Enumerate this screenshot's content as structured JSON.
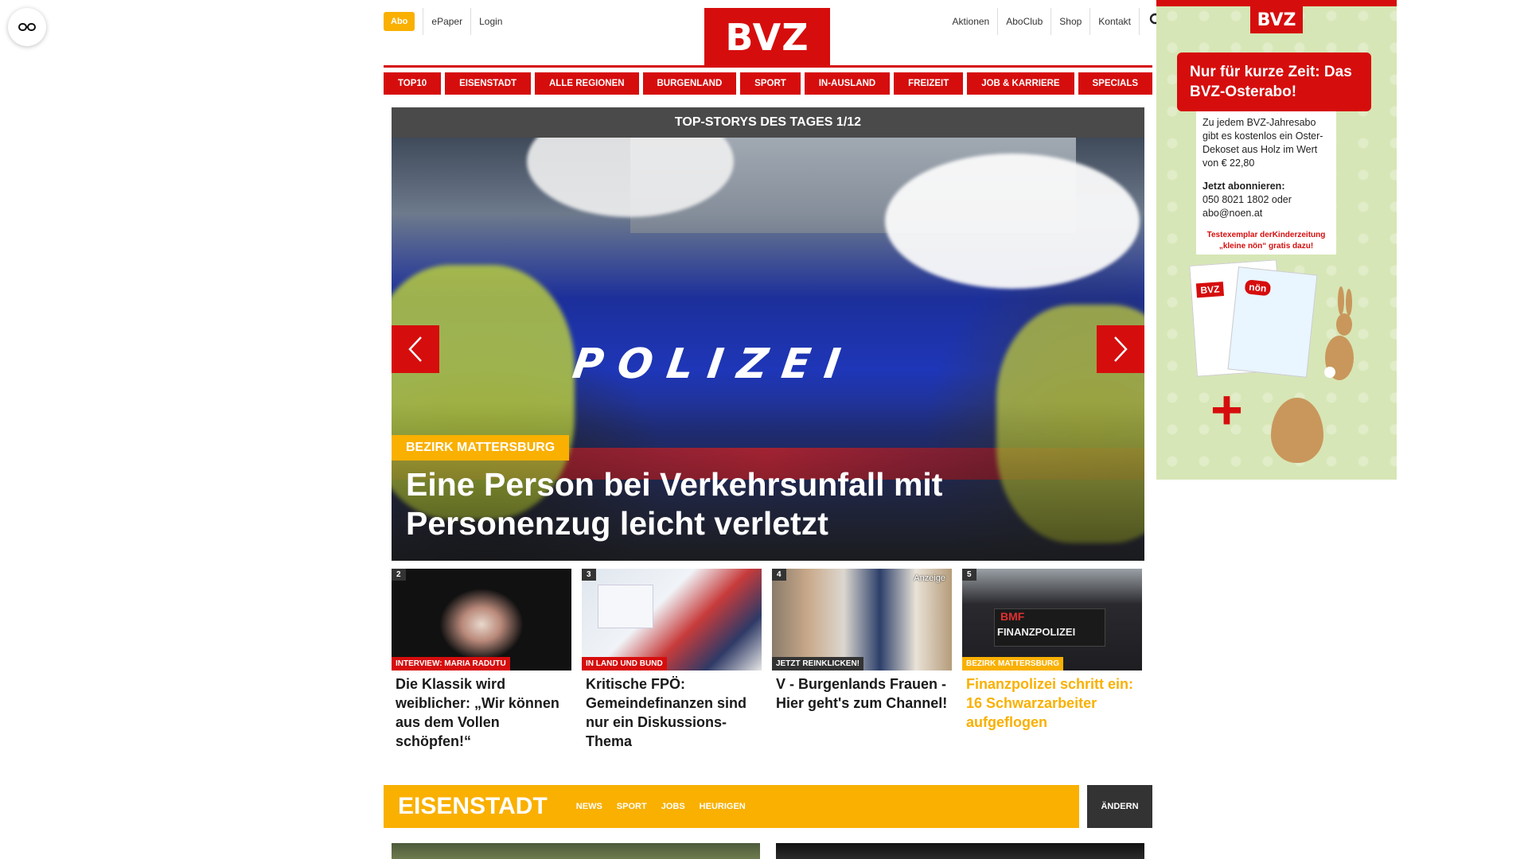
{
  "header": {
    "abo_label": "Abo",
    "left_links": [
      "ePaper",
      "Login"
    ],
    "logo_text": "BVZ",
    "right_links": [
      "Aktionen",
      "AboClub",
      "Shop",
      "Kontakt"
    ]
  },
  "nav": {
    "items": [
      "TOP10",
      "EISENSTADT",
      "ALLE REGIONEN",
      "BURGENLAND",
      "SPORT",
      "IN-AUSLAND",
      "FREIZEIT",
      "JOB & KARRIERE",
      "SPECIALS"
    ]
  },
  "hero": {
    "section_title": "TOP-STORYS DES TAGES 1/12",
    "image_text": "POLIZEI",
    "tag": "BEZIRK MATTERSBURG",
    "headline": "Eine Person bei Verkehrsunfall mit Personenzug leicht verletzt"
  },
  "teasers": [
    {
      "num": "2",
      "tag": "INTERVIEW: MARIA RADUTU",
      "title": "Die Klassik wird weiblicher: „Wir können aus dem Vollen schöpfen!“",
      "ad": ""
    },
    {
      "num": "3",
      "tag": "IN LAND UND BUND",
      "title": "Kritische FPÖ: Gemeindefinanzen sind nur ein Diskussions-Thema",
      "ad": ""
    },
    {
      "num": "4",
      "tag": "JETZT REINKLICKEN!",
      "title": "V - Burgenlands Frauen - Hier geht's zum Channel!",
      "ad": "Anzeige"
    },
    {
      "num": "5",
      "tag": "BEZIRK MATTERSBURG",
      "title": "Finanzpolizei schritt ein: 16 Schwarzarbeiter aufgeflogen",
      "ad": "",
      "image_text_1": "BMF",
      "image_text_2": "FINANZPOLIZEI"
    }
  ],
  "section": {
    "title": "EISENSTADT",
    "links": [
      "NEWS",
      "SPORT",
      "JOBS",
      "HEURIGEN"
    ],
    "change_label": "ÄNDERN"
  },
  "ad": {
    "logo": "BVZ",
    "headline": "Nur für kurze Zeit: Das BVZ-Osterabo!",
    "body": "Zu jedem BVZ-Jahresabo gibt es kostenlos ein Oster-Dekoset aus Holz im Wert von € 22,80",
    "cta_title": "Jetzt abonnieren:",
    "cta_body": "050 8021 1802 oder abo@noen.at",
    "promo": "Testexemplar derKinderzeitung „kleine nön“ gratis dazu!",
    "mag_logo_1": "BVZ",
    "mag_logo_2": "nön"
  },
  "colors": {
    "brand_red": "#d60d0d",
    "accent_yellow": "#f9b000",
    "dark_gray": "#4a4a4a"
  }
}
